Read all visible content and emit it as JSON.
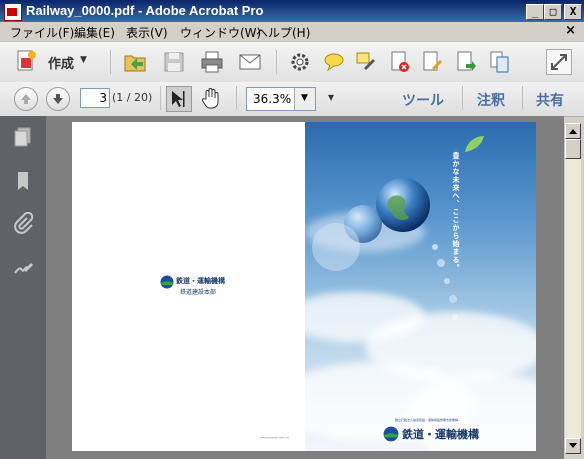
{
  "window": {
    "title": "Railway_0000.pdf - Adobe Acrobat Pro",
    "minimize_glyph": "_",
    "maximize_glyph": "□",
    "close_glyph": "X"
  },
  "menu": {
    "items": [
      "ファイル(F)",
      "編集(E)",
      "表示(V)",
      "ウィンドウ(W)",
      "ヘルプ(H)"
    ],
    "close_doc_glyph": "×"
  },
  "toolbar": {
    "create_label": "作成",
    "create_arrow": "▼"
  },
  "navigation": {
    "page_number": "3",
    "page_count": "(1 / 20)",
    "zoom_value": "36.3%",
    "zoom_arrow": "▼",
    "more_arrow": "▾",
    "tools_label": "ツール",
    "comment_label": "注釈",
    "share_label": "共有"
  },
  "document": {
    "left_logo_line1": "鉄道・運輸機構",
    "left_logo_line2": "鉄道建設本部",
    "cover_tagline": "豊かな未来へ、ここから始まる。",
    "right_logo": "鉄道・運輸機構",
    "right_logo_small": "独立行政法人鉄道建設・運輸施設整備支援機構",
    "footer_text": "━━━━━━━━━━ ━━━ ━━"
  },
  "colors": {
    "titlebar": "#0a246a",
    "accent_text": "#4a6fa5",
    "nav_pane": "#5f6368",
    "doc_bg": "#7f7f7f"
  }
}
